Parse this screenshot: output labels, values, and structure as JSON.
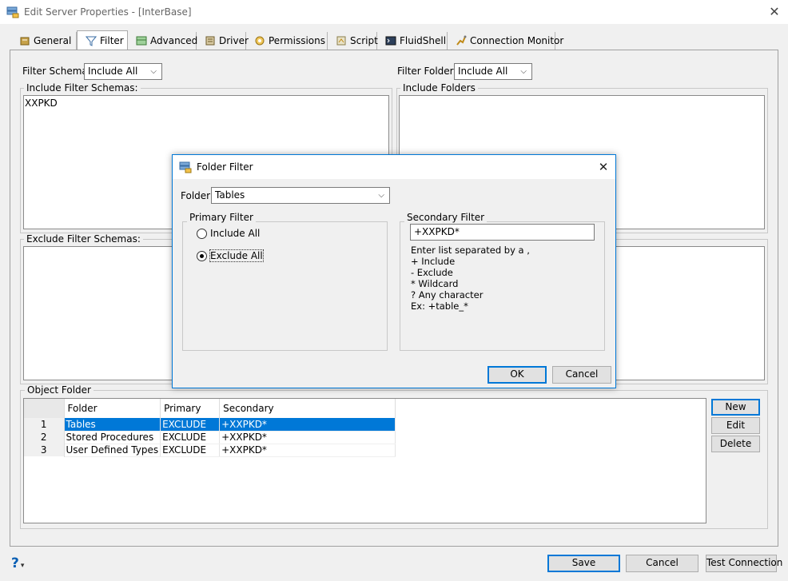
{
  "window": {
    "title": "Edit Server Properties - [InterBase]"
  },
  "tabs": [
    {
      "label": "General",
      "icon": "general-icon"
    },
    {
      "label": "Filter",
      "icon": "filter-icon"
    },
    {
      "label": "Advanced",
      "icon": "advanced-icon"
    },
    {
      "label": "Driver",
      "icon": "driver-icon"
    },
    {
      "label": "Permissions",
      "icon": "permissions-icon"
    },
    {
      "label": "Script",
      "icon": "script-icon"
    },
    {
      "label": "FluidShell",
      "icon": "fluidshell-icon"
    },
    {
      "label": "Connection Monitor",
      "icon": "connection-monitor-icon"
    }
  ],
  "filter": {
    "schemas_label": "Filter Schemas:",
    "schemas_value": "Include All",
    "folders_label": "Filter Folders:",
    "folders_value": "Include All",
    "include_schemas_title": "Include Filter Schemas:",
    "include_schemas_items": [
      "XXPKD"
    ],
    "exclude_schemas_title": "Exclude Filter Schemas:",
    "include_folders_title": "Include Folders"
  },
  "object_folder": {
    "title": "Object Folder",
    "columns": [
      "Folder",
      "Primary",
      "Secondary"
    ],
    "rows": [
      {
        "num": "1",
        "folder": "Tables",
        "primary": "EXCLUDE",
        "secondary": "+XXPKD*"
      },
      {
        "num": "2",
        "folder": "Stored Procedures",
        "primary": "EXCLUDE",
        "secondary": "+XXPKD*"
      },
      {
        "num": "3",
        "folder": "User Defined Types",
        "primary": "EXCLUDE",
        "secondary": "+XXPKD*"
      }
    ],
    "buttons": {
      "new": "New",
      "edit": "Edit",
      "delete": "Delete"
    }
  },
  "footer": {
    "help": "?",
    "save": "Save",
    "cancel": "Cancel",
    "test": "Test Connection"
  },
  "dialog": {
    "title": "Folder Filter",
    "folder_label": "Folder:",
    "folder_value": "Tables",
    "primary_title": "Primary Filter",
    "include_all": "Include All",
    "exclude_all": "Exclude All",
    "secondary_title": "Secondary Filter",
    "secondary_value": "+XXPKD*",
    "hint_lines": [
      "Enter list separated by a ,",
      "+ Include",
      "- Exclude",
      "* Wildcard",
      "? Any character",
      "Ex: +table_*"
    ],
    "ok": "OK",
    "cancel": "Cancel"
  },
  "colors": {
    "accent": "#0078d7",
    "selection": "#0078d7"
  }
}
